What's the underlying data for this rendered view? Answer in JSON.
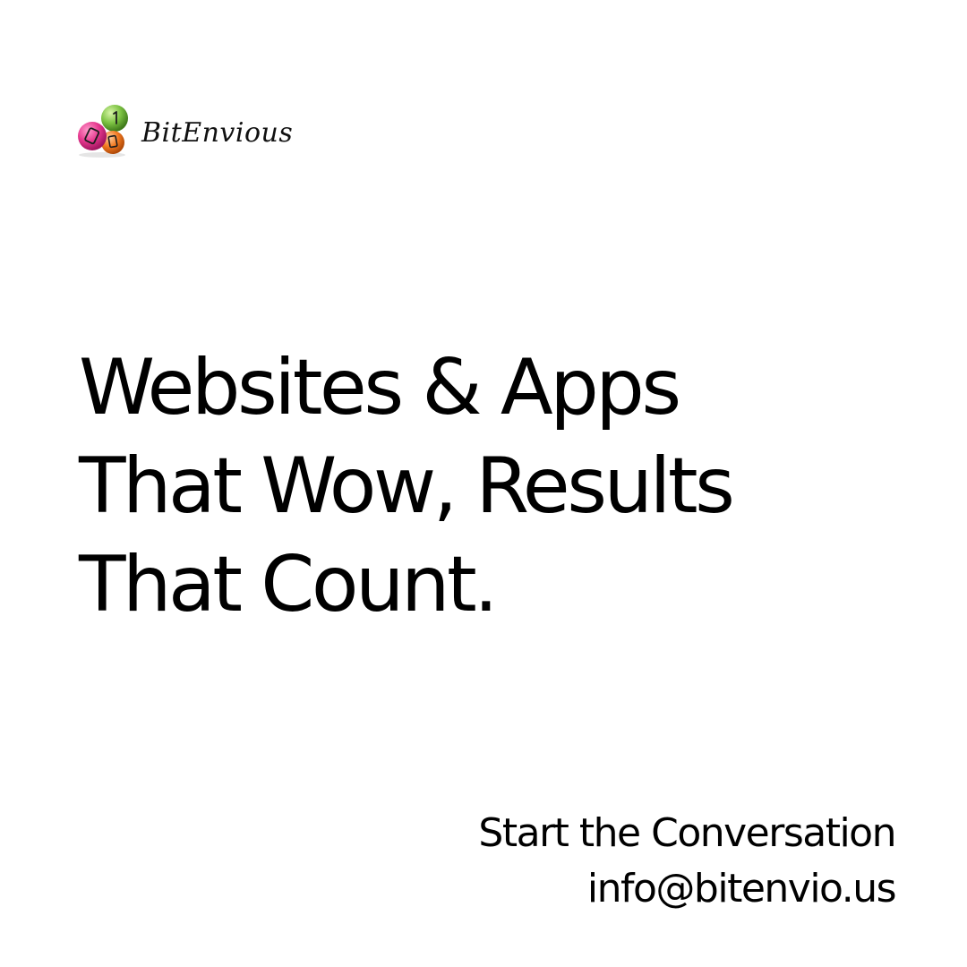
{
  "brand": {
    "logo_text": "BitEnvious",
    "ball_colors": [
      "#e6398f",
      "#7cc242",
      "#f37a21"
    ]
  },
  "headline": {
    "lines": [
      "Websites & Apps",
      "That Wow, Results",
      "That Count."
    ]
  },
  "contact": {
    "cta": "Start the Conversation",
    "email": "info@bitenvio.us"
  }
}
